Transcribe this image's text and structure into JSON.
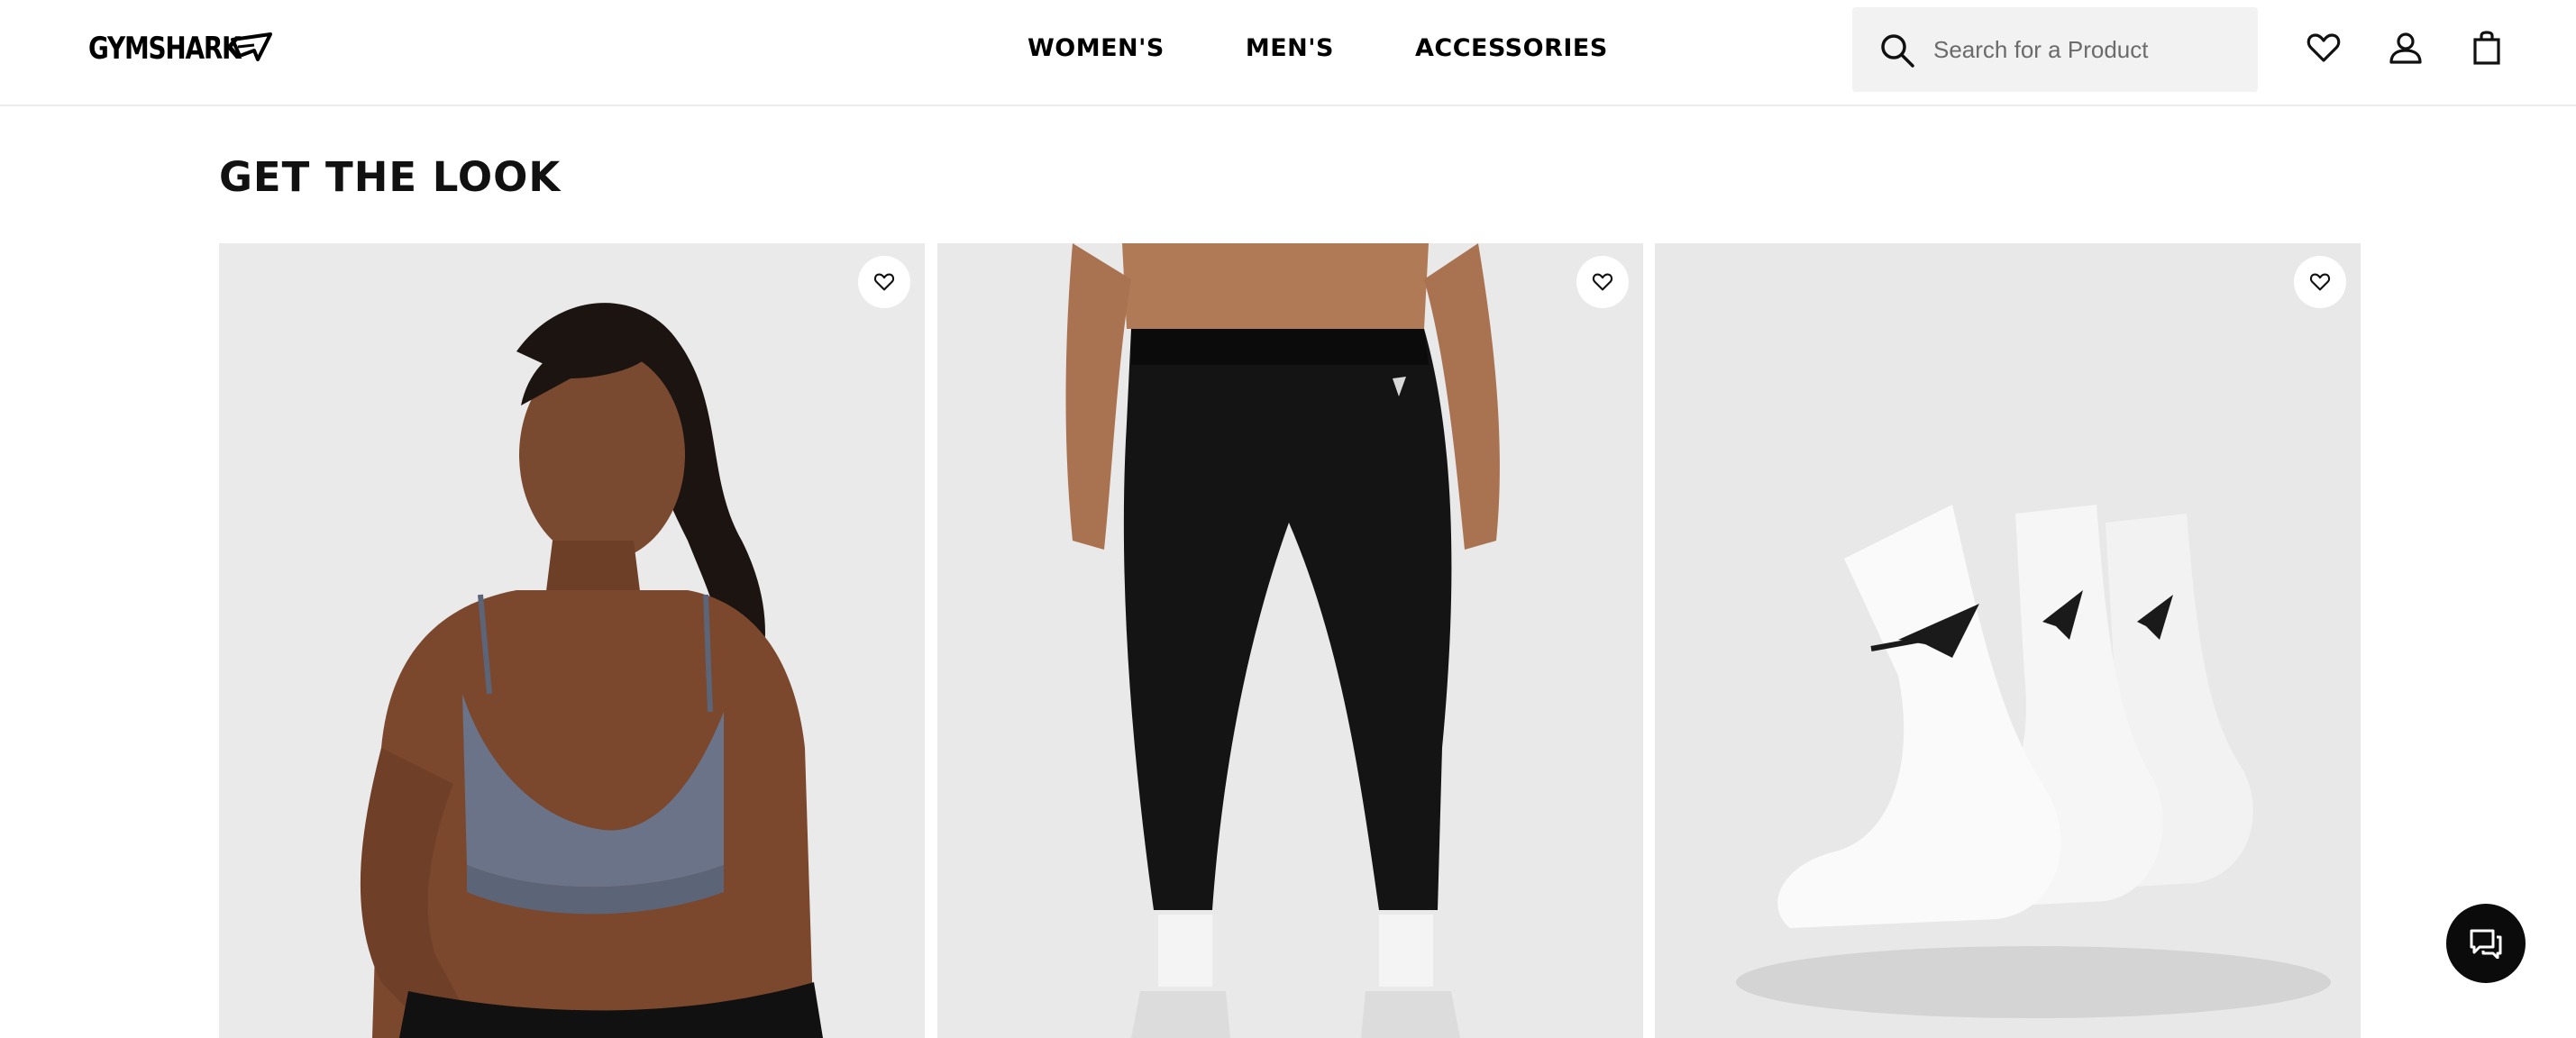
{
  "header": {
    "logo_text": "GYMSHARK",
    "nav": [
      "WOMEN'S",
      "MEN'S",
      "ACCESSORIES"
    ],
    "search_placeholder": "Search for a Product",
    "icons": [
      "search-icon",
      "heart-icon",
      "account-icon",
      "bag-icon"
    ]
  },
  "section": {
    "title": "GET THE LOOK"
  },
  "products": [
    {
      "image": "grey sports bra model",
      "wishlist_icon": "heart-icon"
    },
    {
      "image": "black leggings model",
      "wishlist_icon": "heart-icon"
    },
    {
      "image": "white crew socks 3 pack",
      "wishlist_icon": "heart-icon"
    }
  ],
  "chat": {
    "icon": "chat-icon"
  },
  "colors": {
    "background": "#ffffff",
    "search_bg": "#f2f2f2",
    "card_bg": "#ebebeb",
    "chat_button": "#0b0b0b"
  }
}
